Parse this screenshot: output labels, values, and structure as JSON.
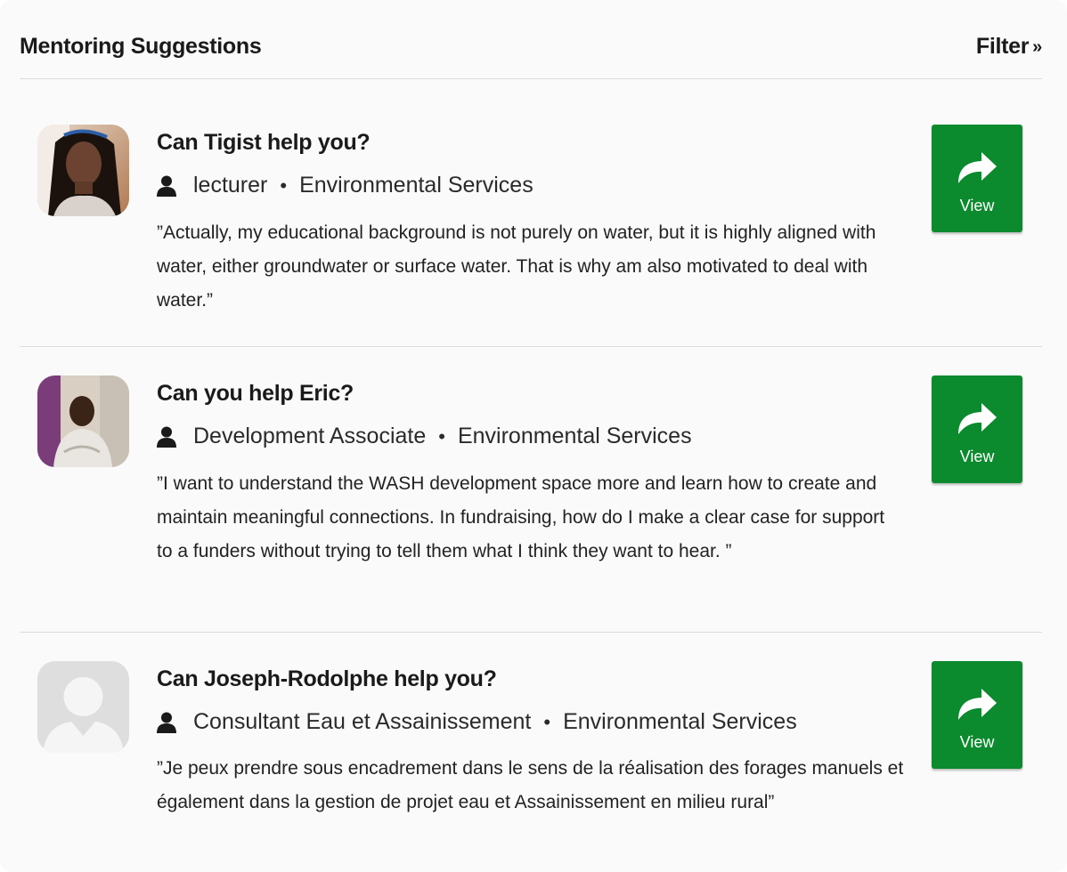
{
  "header": {
    "title": "Mentoring Suggestions",
    "filter_label": "Filter",
    "filter_chevron": "»"
  },
  "cards": [
    {
      "title": "Can Tigist help you?",
      "role": "lecturer",
      "separator": "•",
      "sector": "Environmental Services",
      "quote": "”Actually, my educational background is not purely on water, but it is highly aligned with water, either groundwater or surface water. That is why am also motivated to deal with water.”",
      "button_label": "View",
      "avatar": "photo-woman"
    },
    {
      "title": "Can you help Eric?",
      "role": "Development Associate",
      "separator": "•",
      "sector": "Environmental Services",
      "quote": "”I want to understand the WASH development space more and learn how to create and maintain meaningful connections. In fundraising, how do I make a clear case for support to a funders without trying to tell them what I think they want to hear. ”",
      "button_label": "View",
      "avatar": "photo-man"
    },
    {
      "title": "Can Joseph-Rodolphe help you?",
      "role": "Consultant Eau et Assainissement",
      "separator": "•",
      "sector": "Environmental Services",
      "quote": "”Je peux prendre sous encadrement dans le sens de la réalisation des forages manuels et également dans la gestion de projet eau et Assainissement en milieu rural”",
      "button_label": "View",
      "avatar": "placeholder"
    }
  ],
  "colors": {
    "button": "#0b8a2e",
    "divider": "#dcdcdc",
    "panel": "#fafafa"
  }
}
